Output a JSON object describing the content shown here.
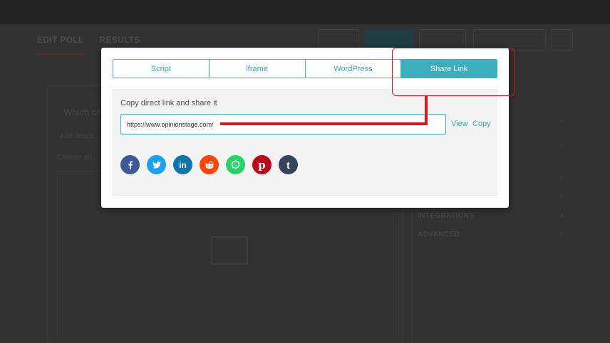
{
  "background": {
    "tabs": [
      "EDIT POLL",
      "RESULTS"
    ],
    "question_prefix": "Which of",
    "line1": "Add descri...",
    "line2": "Choose an...",
    "right_items": [
      "INTEGRATIONS",
      "ADVANCED"
    ]
  },
  "modal": {
    "tabs": [
      {
        "label": "Script",
        "active": false
      },
      {
        "label": "iframe",
        "active": false
      },
      {
        "label": "WordPress",
        "active": false
      },
      {
        "label": "Share Link",
        "active": true
      }
    ],
    "share_link": {
      "label": "Copy direct link and share it",
      "url": "https://www.opinionstage.com/",
      "view_label": "View",
      "copy_label": "Copy"
    },
    "social": [
      {
        "name": "facebook",
        "glyph": "f",
        "color": "#3b5998"
      },
      {
        "name": "twitter",
        "glyph": "t",
        "color": "#1da1f2"
      },
      {
        "name": "linkedin",
        "glyph": "in",
        "color": "#0e76a8"
      },
      {
        "name": "reddit",
        "glyph": "r",
        "color": "#ff4500"
      },
      {
        "name": "whatsapp",
        "glyph": "w",
        "color": "#25d366"
      },
      {
        "name": "pinterest",
        "glyph": "p",
        "color": "#bd081c"
      },
      {
        "name": "tumblr",
        "glyph": "t",
        "color": "#35465c"
      }
    ]
  },
  "colors": {
    "accent": "#3aafbd",
    "annotation": "#e1141c"
  }
}
